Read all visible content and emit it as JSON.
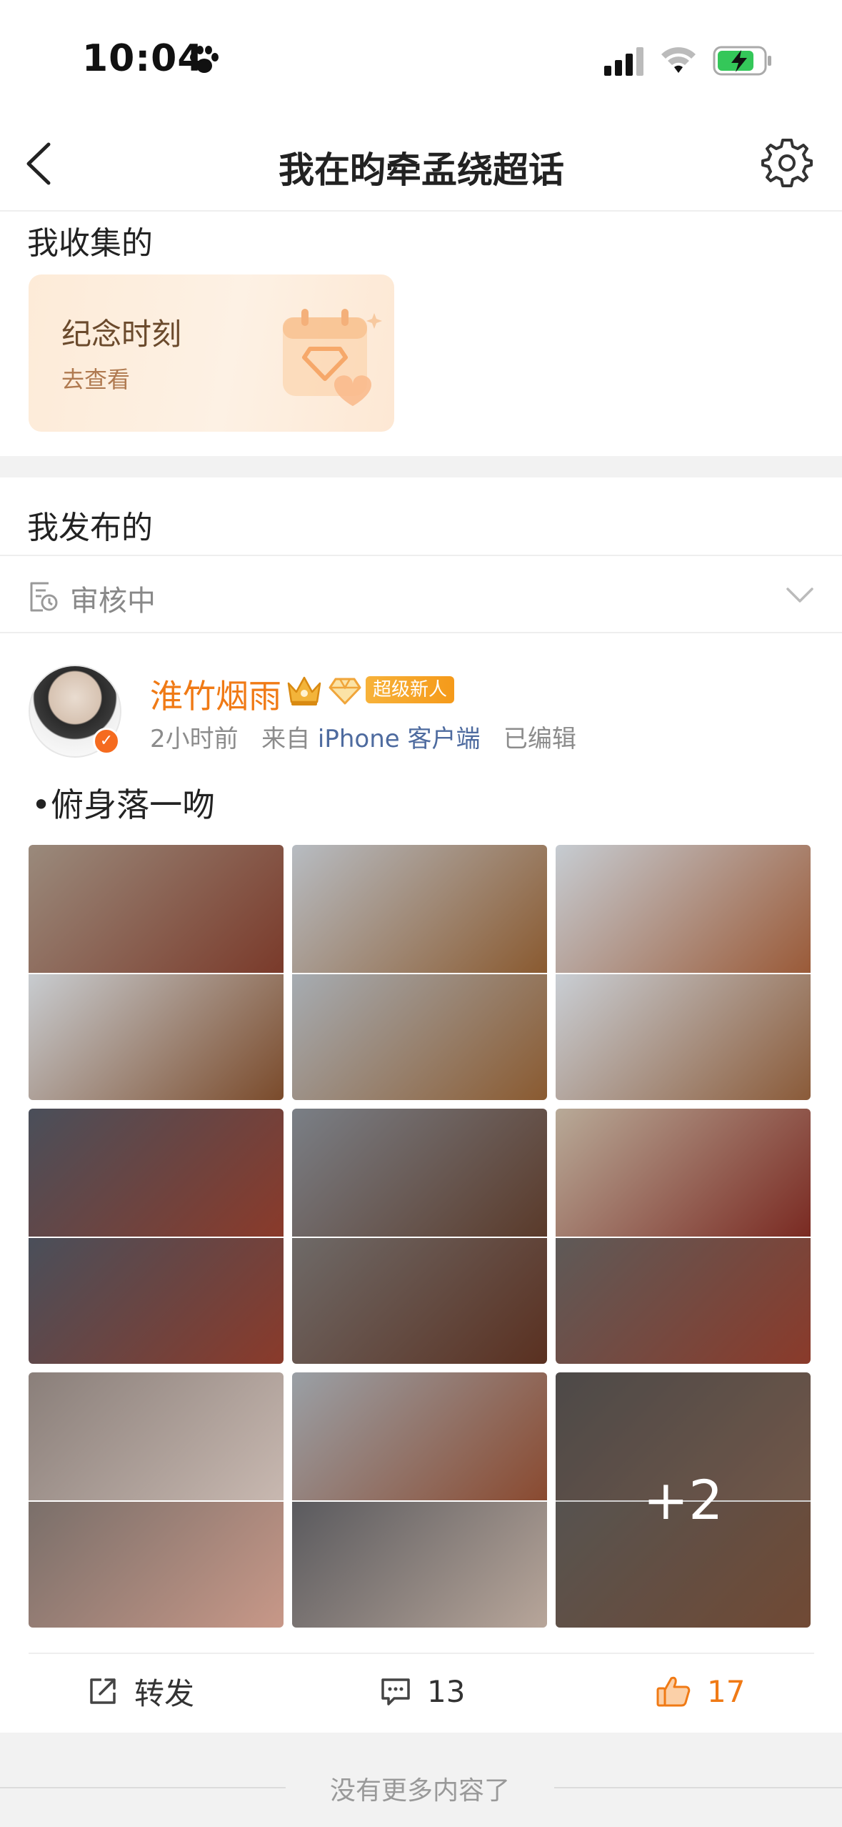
{
  "status_bar": {
    "time": "10:04"
  },
  "nav": {
    "title": "我在昀牵孟绕超话"
  },
  "collected": {
    "section_label": "我收集的",
    "card_title": "纪念时刻",
    "card_action": "去查看"
  },
  "published": {
    "section_label": "我发布的",
    "review_status": "审核中"
  },
  "post": {
    "username": "淮竹烟雨",
    "tag": "超级新人",
    "time": "2小时前",
    "source_prefix": "来自",
    "source": "iPhone 客户端",
    "edited": "已编辑",
    "text": "•俯身落一吻",
    "more_images": "+2",
    "images": [
      {
        "top": [
          "#9a8a7c",
          "#7a3a2a"
        ],
        "bottom": [
          "#c8ccd0",
          "#7a4a2a"
        ]
      },
      {
        "top": [
          "#b7bcc2",
          "#8a5a30"
        ],
        "bottom": [
          "#a6acb2",
          "#8a5a30"
        ]
      },
      {
        "top": [
          "#c6ccd2",
          "#9a5a38"
        ],
        "bottom": [
          "#c9ced4",
          "#8a5a38"
        ]
      },
      {
        "top": [
          "#4a4f5a",
          "#8a3a2a"
        ],
        "bottom": [
          "#4a4f5a",
          "#8a3a2a"
        ]
      },
      {
        "top": [
          "#7a7f86",
          "#5a3a2a"
        ],
        "bottom": [
          "#6e6a68",
          "#5a3020"
        ]
      },
      {
        "top": [
          "#b8aa98",
          "#7a2a22"
        ],
        "bottom": [
          "#5e5a58",
          "#8a3a2a"
        ]
      },
      {
        "top": [
          "#8a7f7a",
          "#c8b8b0"
        ],
        "bottom": [
          "#7a6f6a",
          "#c89888"
        ]
      },
      {
        "top": [
          "#9aa0a6",
          "#8a4a30"
        ],
        "bottom": [
          "#5a5a5e",
          "#b8a69a"
        ]
      },
      {
        "top": [
          "#5e5a58",
          "#8a6a58"
        ],
        "bottom": [
          "#6a6662",
          "#8a5a40"
        ]
      }
    ]
  },
  "actions": {
    "repost_label": "转发",
    "comment_count": "13",
    "like_count": "17"
  },
  "footer": {
    "text": "没有更多内容了"
  },
  "colors": {
    "accent": "#f07a15",
    "link": "#4e6b9f",
    "muted": "#8c8c8c"
  }
}
